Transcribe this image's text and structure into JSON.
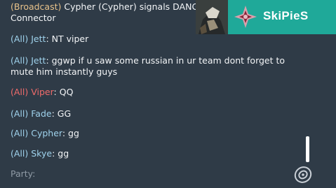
{
  "chat": {
    "broadcast": {
      "channel": "(Broadcast)",
      "text": " Cypher (Cypher) signals DANGER near Mid Connector"
    },
    "messages": [
      {
        "channel": "(All)",
        "sender": "Jett",
        "text": ": NT viper",
        "team": "ally"
      },
      {
        "channel": "(All)",
        "sender": "Jett",
        "text": ": ggwp if u saw some russian in ur team dont forget to mute him instantly guys",
        "team": "ally"
      },
      {
        "channel": "(All)",
        "sender": "Viper",
        "text": ": QQ",
        "team": "enemy"
      },
      {
        "channel": "(All)",
        "sender": "Fade",
        "text": ": GG",
        "team": "ally"
      },
      {
        "channel": "(All)",
        "sender": "Cypher",
        "text": ": gg",
        "team": "ally"
      },
      {
        "channel": "(All)",
        "sender": "Skye",
        "text": ": gg",
        "team": "ally"
      }
    ],
    "input_label": "Party:"
  },
  "player_banner": {
    "name": "SkiPieS",
    "color": "#1fa999",
    "rank_icon": "rank-emblem-icon"
  },
  "colors": {
    "ally": "#9fd2ec",
    "enemy": "#f06b6b",
    "broadcast": "#e8c28a",
    "chat_bg": "#2f3b47"
  }
}
